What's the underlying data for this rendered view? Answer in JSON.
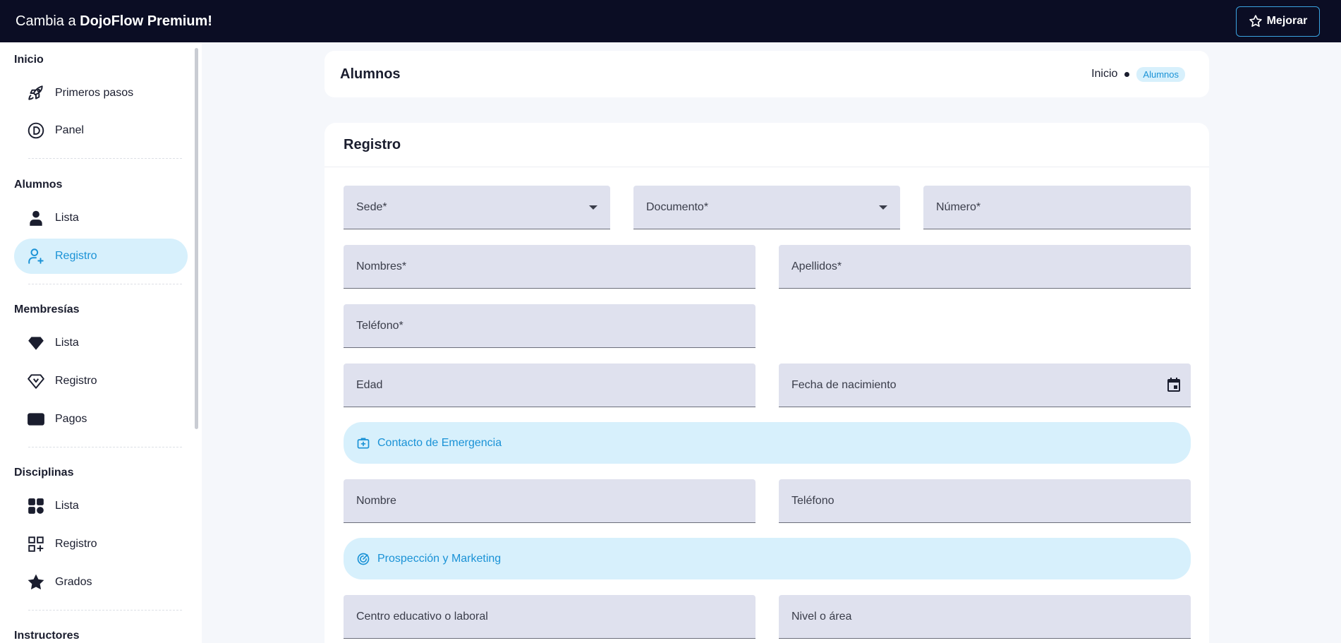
{
  "topbar": {
    "title_prefix": "Cambia a ",
    "title_brand": "DojoFlow Premium!",
    "upgrade_label": "Mejorar"
  },
  "sidebar": {
    "sections": {
      "inicio": "Inicio",
      "alumnos": "Alumnos",
      "membresias": "Membresías",
      "disciplinas": "Disciplinas",
      "instructores": "Instructores"
    },
    "items": {
      "primeros_pasos": "Primeros pasos",
      "panel": "Panel",
      "alumnos_lista": "Lista",
      "alumnos_registro": "Registro",
      "membresias_lista": "Lista",
      "membresias_registro": "Registro",
      "membresias_pagos": "Pagos",
      "disciplinas_lista": "Lista",
      "disciplinas_registro": "Registro",
      "disciplinas_grados": "Grados"
    }
  },
  "header": {
    "title": "Alumnos",
    "breadcrumb_home": "Inicio",
    "breadcrumb_current": "Alumnos"
  },
  "form": {
    "title": "Registro",
    "fields": {
      "sede": "Sede*",
      "documento": "Documento*",
      "numero": "Número*",
      "nombres": "Nombres*",
      "apellidos": "Apellidos*",
      "telefono": "Teléfono*",
      "edad": "Edad",
      "fecha_nacimiento": "Fecha de nacimiento",
      "contacto_nombre": "Nombre",
      "contacto_telefono": "Teléfono",
      "centro": "Centro educativo o laboral",
      "nivel": "Nivel o área"
    },
    "sections": {
      "emergencia": "Contacto de Emergencia",
      "marketing": "Prospección y Marketing"
    }
  },
  "colors": {
    "topbar_bg": "#0b0d24",
    "accent": "#1a92d6",
    "accent_bg": "#d7f0fc",
    "field_bg": "#dfe1ee"
  }
}
